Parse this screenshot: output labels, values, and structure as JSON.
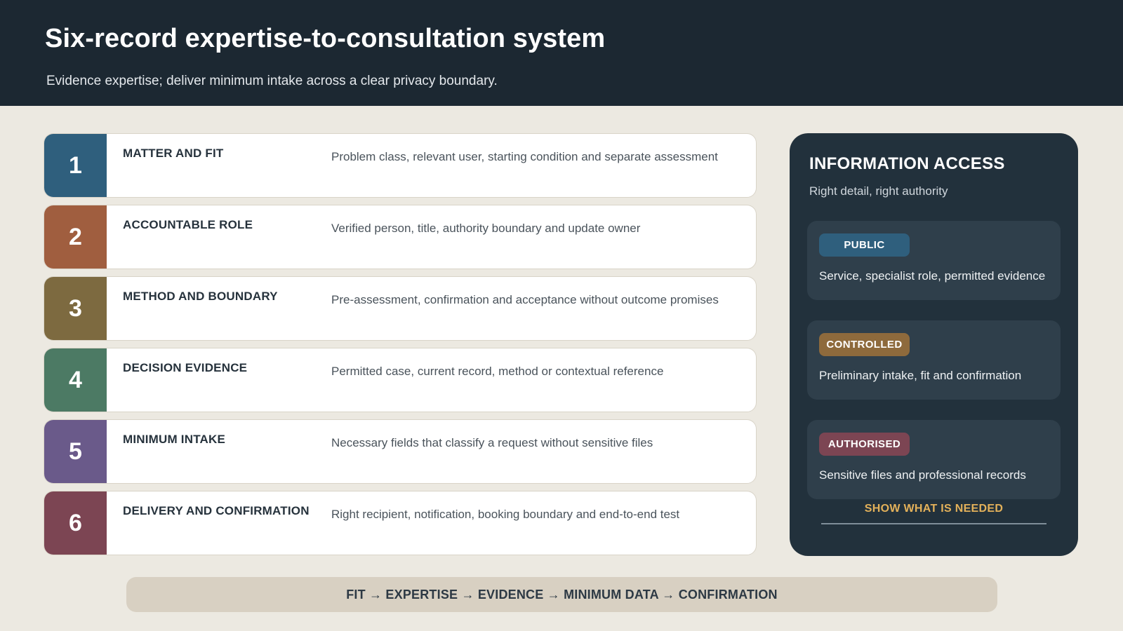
{
  "header": {
    "title": "Six-record expertise-to-consultation system",
    "subtitle": "Evidence expertise; deliver minimum intake across a clear privacy boundary."
  },
  "records": [
    {
      "number": "1",
      "title": "MATTER AND FIT",
      "description": "Problem class, relevant user, starting condition and separate assessment",
      "color": "#2f5f7d"
    },
    {
      "number": "2",
      "title": "ACCOUNTABLE ROLE",
      "description": "Verified person, title, authority boundary and update owner",
      "color": "#a05e3f"
    },
    {
      "number": "3",
      "title": "METHOD AND BOUNDARY",
      "description": "Pre-assessment, confirmation and acceptance without outcome promises",
      "color": "#7d6a40"
    },
    {
      "number": "4",
      "title": "DECISION EVIDENCE",
      "description": "Permitted case, current record, method or contextual reference",
      "color": "#4c7a64"
    },
    {
      "number": "5",
      "title": "MINIMUM INTAKE",
      "description": "Necessary fields that classify a request without sensitive files",
      "color": "#6a5a8a"
    },
    {
      "number": "6",
      "title": "DELIVERY AND CONFIRMATION",
      "description": "Right recipient, notification, booking boundary and end-to-end test",
      "color": "#7c4553"
    }
  ],
  "panel": {
    "title": "INFORMATION ACCESS",
    "subtitle": "Right detail, right authority",
    "tiers": [
      {
        "badge": "PUBLIC",
        "description": "Service, specialist role, permitted evidence",
        "color": "#2f5f7d"
      },
      {
        "badge": "CONTROLLED",
        "description": "Preliminary intake, fit and confirmation",
        "color": "#8e6a3c"
      },
      {
        "badge": "AUTHORISED",
        "description": "Sensitive files and professional records",
        "color": "#7c4553"
      }
    ],
    "footer": "SHOW WHAT IS NEEDED"
  },
  "flow": {
    "text": "FIT → EXPERTISE → EVIDENCE → MINIMUM DATA → CONFIRMATION"
  }
}
